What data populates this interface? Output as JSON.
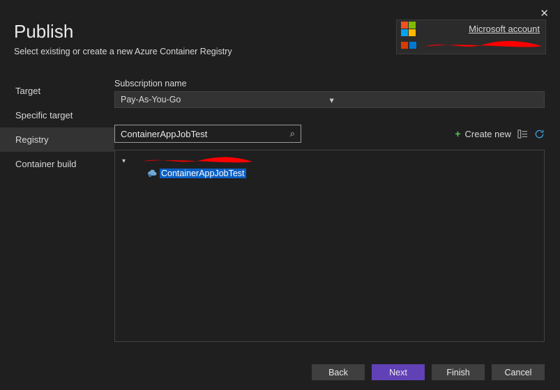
{
  "header": {
    "title": "Publish",
    "subtitle": "Select existing or create a new Azure Container Registry",
    "close_glyph": "✕"
  },
  "account": {
    "title": "Microsoft account"
  },
  "nav": {
    "items": [
      {
        "label": "Target"
      },
      {
        "label": "Specific target"
      },
      {
        "label": "Registry",
        "active": true
      },
      {
        "label": "Container build"
      }
    ]
  },
  "subscription": {
    "label": "Subscription name",
    "value": "Pay-As-You-Go"
  },
  "search": {
    "value": "ContainerAppJobTest",
    "icon_glyph": "⌕"
  },
  "actions": {
    "create_new_label": "Create new",
    "create_new_plus": "+"
  },
  "tree": {
    "selected_label": "ContainerAppJobTest"
  },
  "buttons": {
    "back": "Back",
    "next": "Next",
    "finish": "Finish",
    "cancel": "Cancel"
  }
}
